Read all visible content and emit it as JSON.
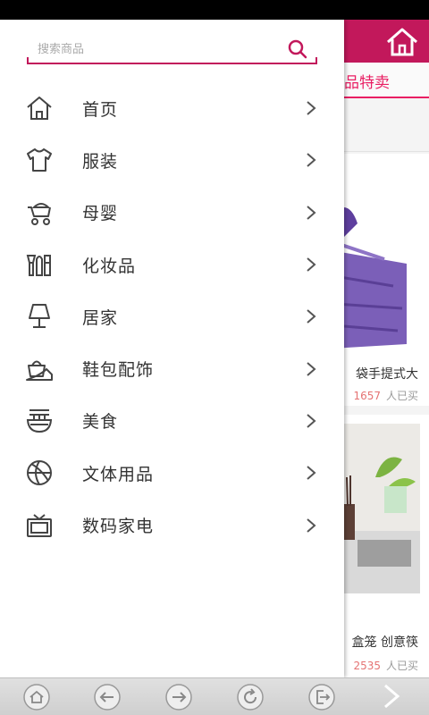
{
  "background": {
    "tab_title": "品特卖",
    "products": [
      {
        "title": "袋手提式大",
        "sold_count": "1657",
        "sold_suffix": "人已买"
      },
      {
        "title": "盒笼 创意筷",
        "sold_count": "2535",
        "sold_suffix": "人已买"
      }
    ],
    "accent_color": "#c2185b"
  },
  "drawer": {
    "search": {
      "placeholder": "搜索商品",
      "value": ""
    },
    "menu": [
      {
        "label": "首页",
        "icon": "home-icon"
      },
      {
        "label": "服装",
        "icon": "tshirt-icon"
      },
      {
        "label": "母婴",
        "icon": "stroller-icon"
      },
      {
        "label": "化妆品",
        "icon": "cosmetics-icon"
      },
      {
        "label": "居家",
        "icon": "lamp-icon"
      },
      {
        "label": "鞋包配饰",
        "icon": "shoe-bag-icon"
      },
      {
        "label": "美食",
        "icon": "noodle-bowl-icon"
      },
      {
        "label": "文体用品",
        "icon": "basketball-icon"
      },
      {
        "label": "数码家电",
        "icon": "tv-icon"
      }
    ]
  },
  "bottom_nav": [
    "home-icon",
    "back-icon",
    "forward-icon",
    "refresh-icon",
    "exit-icon",
    "next-icon"
  ]
}
